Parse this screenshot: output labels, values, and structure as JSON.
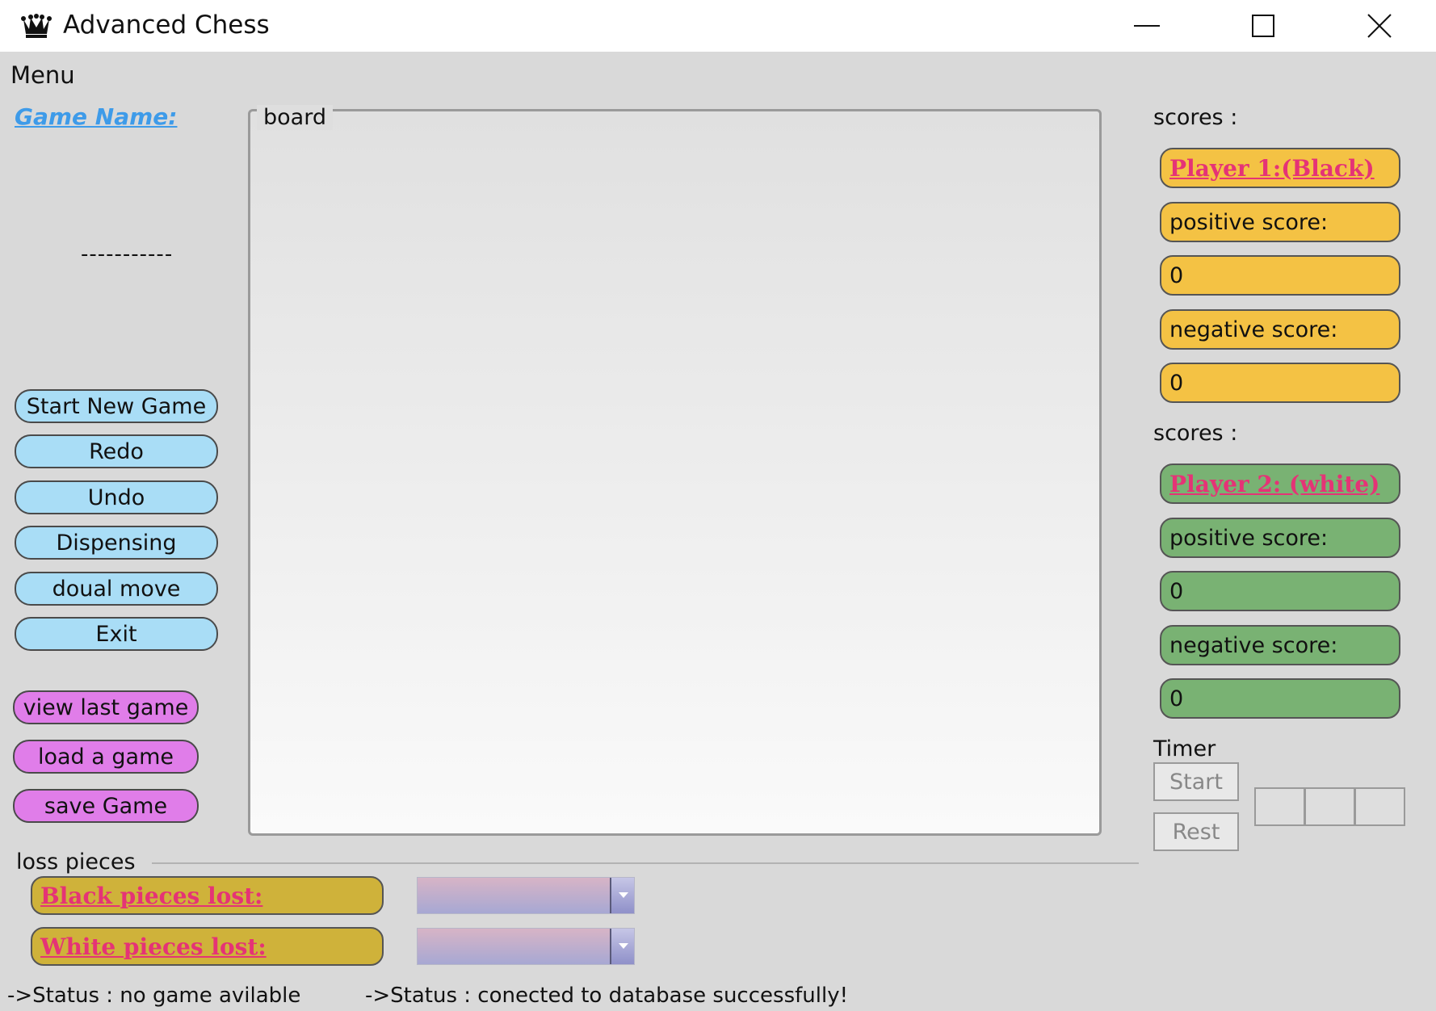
{
  "window": {
    "title": "Advanced Chess",
    "icon": "chess-queen-icon",
    "controls": [
      "minimize-icon",
      "maximize-icon",
      "close-icon"
    ]
  },
  "menu": {
    "label": "Menu"
  },
  "left_panel": {
    "game_name_label": "Game Name:",
    "game_name_value": "-----------",
    "actions": [
      "Start New Game",
      "Redo",
      "Undo",
      "Dispensing",
      "doual move",
      "Exit"
    ],
    "file_actions": [
      "view last game",
      "load a game",
      "save Game"
    ]
  },
  "board": {
    "title": "board"
  },
  "player1": {
    "scores_label": "scores :",
    "name": "Player 1:(Black)",
    "positive_label": "positive score:",
    "positive_value": "0",
    "negative_label": "negative score:",
    "negative_value": "0"
  },
  "player2": {
    "scores_label": "scores :",
    "name": "Player 2: (white)",
    "positive_label": "positive score:",
    "positive_value": "0",
    "negative_label": "negative score:",
    "negative_value": "0"
  },
  "timer": {
    "label": "Timer",
    "start": "Start",
    "reset": "Rest"
  },
  "loss": {
    "label": "loss pieces",
    "black": "Black pieces lost:",
    "white": "White pieces lost:"
  },
  "status": {
    "left": "->Status : no game avilable",
    "right": "->Status : conected to database successfully!"
  },
  "colors": {
    "blue_button": "#a9ddf6",
    "purple_button": "#e07de9",
    "player1_box": "#f4c244",
    "player2_box": "#79b273",
    "loss_box": "#cfb23a",
    "link_text": "#e53376",
    "game_name_text": "#3e9be9"
  }
}
